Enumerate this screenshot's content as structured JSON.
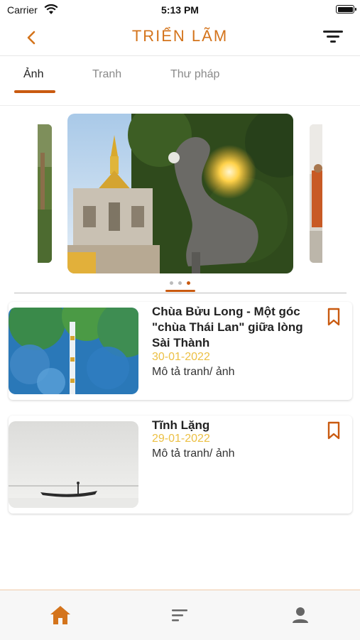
{
  "status_bar": {
    "carrier": "Carrier",
    "time": "5:13 PM"
  },
  "header": {
    "title": "TRIỂN LÃM",
    "back_icon": "chevron-left-icon",
    "filter_icon": "filter-icon"
  },
  "tabs": [
    {
      "label": "Ảnh",
      "active": true
    },
    {
      "label": "Tranh",
      "active": false
    },
    {
      "label": "Thư pháp",
      "active": false
    }
  ],
  "carousel": {
    "slide_count": 3,
    "active_index": 2
  },
  "items": [
    {
      "title": "Chùa Bửu Long - Một góc \"chùa Thái Lan\" giữa lòng Sài Thành",
      "date": "30-01-2022",
      "description": "Mô tả tranh/ ảnh",
      "bookmark_icon": "bookmark-icon"
    },
    {
      "title": "Tĩnh Lặng",
      "date": "29-01-2022",
      "description": "Mô tả tranh/ ảnh",
      "bookmark_icon": "bookmark-icon"
    }
  ],
  "bottom_nav": [
    {
      "icon": "home-icon",
      "active": true
    },
    {
      "icon": "list-icon",
      "active": false
    },
    {
      "icon": "profile-icon",
      "active": false
    }
  ],
  "colors": {
    "accent": "#d4741c",
    "accent_dark": "#c95a10",
    "date": "#ecc044"
  }
}
